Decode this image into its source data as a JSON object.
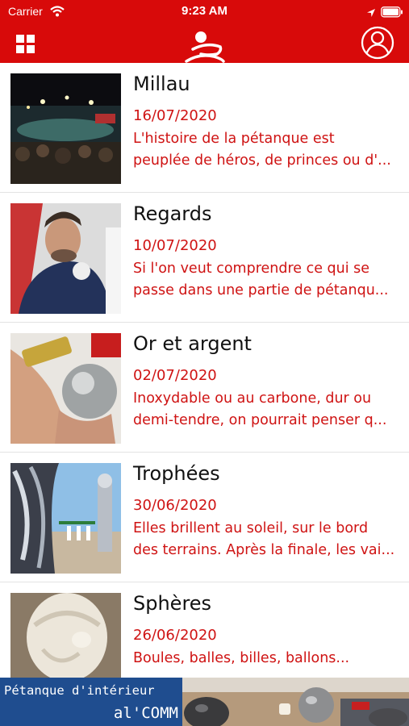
{
  "status_bar": {
    "carrier": "Carrier",
    "time": "9:23 AM"
  },
  "nav": {
    "menu_icon": "grid-icon",
    "logo_icon": "petanque-logo-icon",
    "profile_icon": "user-circle-icon"
  },
  "colors": {
    "brand_red": "#d80a0a",
    "text_red": "#cf1313",
    "banner_blue": "#1f4d8f"
  },
  "articles": [
    {
      "title": "Millau",
      "date": "16/07/2020",
      "line1": "L'histoire de la pétanque est",
      "line2": "peuplée de héros, de princes ou d'..."
    },
    {
      "title": "Regards",
      "date": "10/07/2020",
      "line1": "Si l'on veut comprendre ce qui se",
      "line2": "passe dans une partie de pétanqu..."
    },
    {
      "title": "Or et argent",
      "date": "02/07/2020",
      "line1": "Inoxydable ou au carbone, dur ou",
      "line2": "demi-tendre, on pourrait penser q..."
    },
    {
      "title": "Trophées",
      "date": "30/06/2020",
      "line1": "Elles brillent au soleil, sur le bord",
      "line2": "des terrains. Après la finale, les vai..."
    },
    {
      "title": "Sphères",
      "date": "26/06/2020",
      "line1": "Boules, balles, billes, ballons...",
      "line2": ""
    }
  ],
  "banner": {
    "line1": "Pétanque d'intérieur",
    "line2": "al'COMM"
  }
}
